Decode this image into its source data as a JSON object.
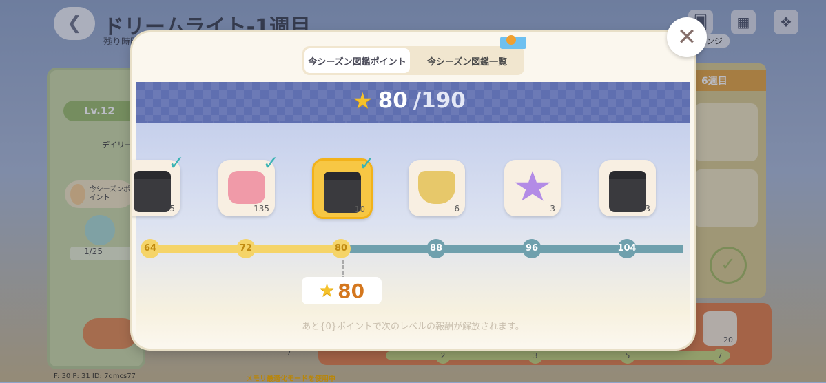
{
  "background": {
    "title": "ドリームライト-1週目",
    "subtitle": "残り時間",
    "level": "Lv.12",
    "daily_label": "デイリー",
    "season_label": "今シーズンポイント",
    "mission_count": "1/25",
    "week6_label": "6週目",
    "challenge_tag": "ンジ",
    "progress_numbers": [
      "2",
      "3",
      "5",
      "7"
    ],
    "bottom_reward_count": "20",
    "left_bottom_number": "7"
  },
  "modal": {
    "tabs": [
      {
        "label": "今シーズン図鑑ポイント",
        "active": true
      },
      {
        "label": "今シーズン図鑑一覧",
        "active": false
      }
    ],
    "points": {
      "current": "80",
      "max": "/190"
    },
    "rewards": [
      {
        "icon": "clapper-box-icon",
        "count": "5",
        "claimed": true
      },
      {
        "icon": "pink-backpack-icon",
        "count": "135",
        "claimed": true
      },
      {
        "icon": "clapper-box-icon",
        "count": "10",
        "claimed": true,
        "current": true
      },
      {
        "icon": "shield-clock-badge-icon",
        "count": "6",
        "claimed": false
      },
      {
        "icon": "purple-star-icon",
        "count": "3",
        "claimed": false
      },
      {
        "icon": "clapper-box-icon",
        "count": "3",
        "claimed": false
      }
    ],
    "milestones": [
      "64",
      "72",
      "80",
      "88",
      "96",
      "104"
    ],
    "current_points": "80",
    "hint": "あと{0}ポイントで次のレベルの報酬が解放されます。",
    "close_symbol": "✕"
  },
  "debug": {
    "text": "F: 30   P: 31   ID: 7dmcs77",
    "memory": "メモリ最適化モードを使用中"
  }
}
